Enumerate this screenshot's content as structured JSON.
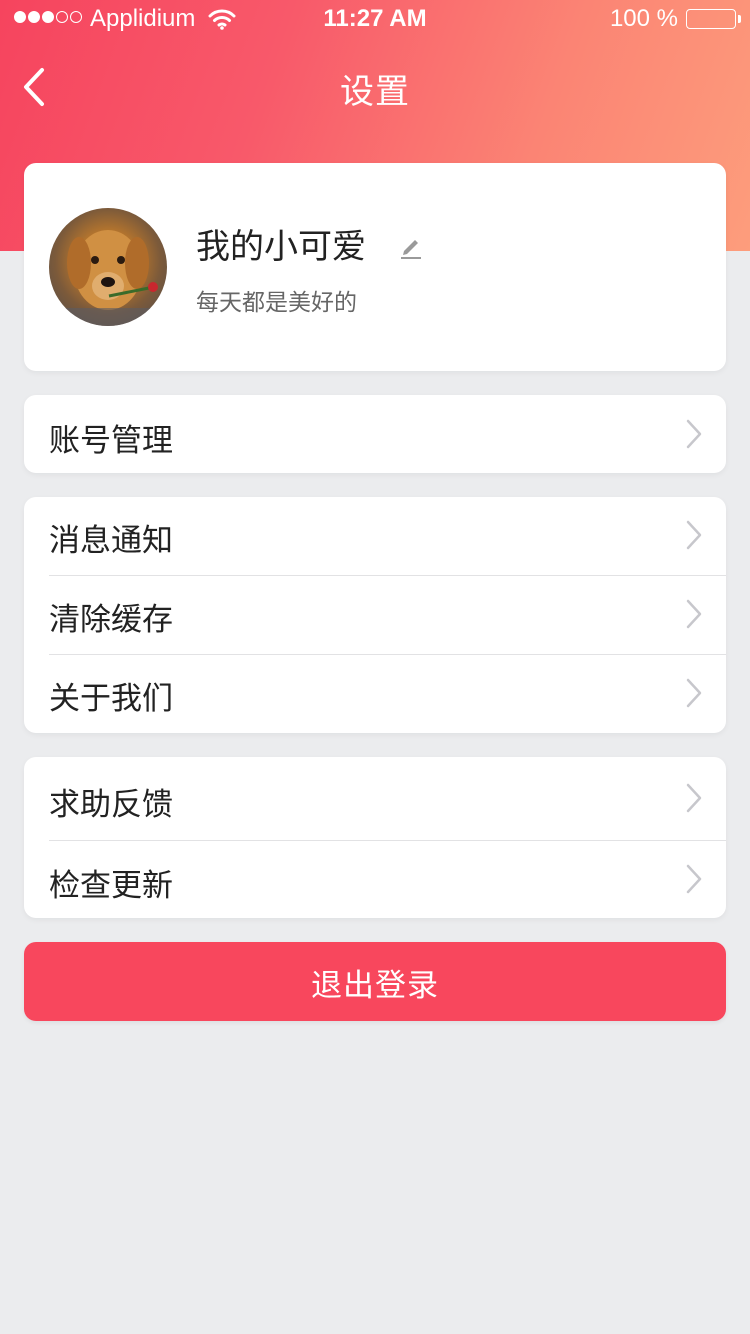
{
  "status_bar": {
    "carrier": "Applidium",
    "time": "11:27 AM",
    "battery": "100 %"
  },
  "nav": {
    "title": "设置",
    "back_icon": "chevron-left-icon"
  },
  "profile": {
    "name": "我的小可爱",
    "motto": "每天都是美好的",
    "edit_icon": "pencil-icon"
  },
  "groups": [
    {
      "items": [
        {
          "label": "账号管理"
        }
      ]
    },
    {
      "items": [
        {
          "label": "消息通知"
        },
        {
          "label": "清除缓存"
        },
        {
          "label": "关于我们"
        }
      ]
    },
    {
      "items": [
        {
          "label": "求助反馈"
        },
        {
          "label": "检查更新"
        }
      ]
    }
  ],
  "logout": {
    "label": "退出登录"
  },
  "colors": {
    "accent": "#f8475d",
    "header_start": "#f6445e",
    "header_end": "#fd9d7c",
    "background": "#ebecee"
  }
}
